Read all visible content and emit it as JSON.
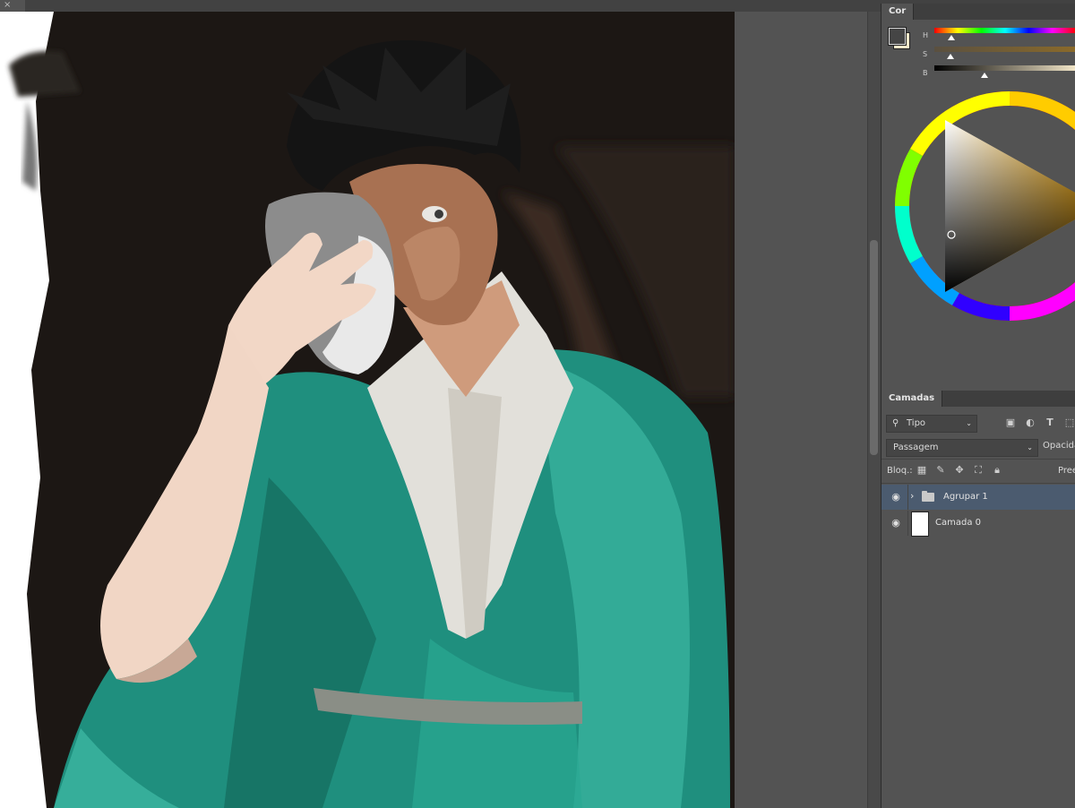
{
  "document_tab": {
    "close_glyph": "×"
  },
  "color_panel": {
    "tab_label": "Cor",
    "sliders": [
      {
        "label": "H",
        "value_fraction": 0.12
      },
      {
        "label": "S",
        "value_fraction": 0.12
      },
      {
        "label": "B",
        "value_fraction": 0.36
      }
    ],
    "foreground_color": "#454545",
    "background_color": "#f3e7c9",
    "wheel_hue_color": "#f5a700"
  },
  "layers_panel": {
    "tab_label": "Camadas",
    "filter": {
      "label": "Tipo",
      "icon": "search-icon"
    },
    "filter_icons": [
      "image-filter-icon",
      "adjustment-filter-icon",
      "type-filter-icon",
      "shape-filter-icon"
    ],
    "blend_mode": "Passagem",
    "opacity_label": "Opacida",
    "lock_label": "Bloq.:",
    "lock_icons": [
      "lock-transparent-pixels-icon",
      "lock-image-pixels-icon",
      "lock-position-icon",
      "lock-artboard-icon",
      "lock-all-icon"
    ],
    "fill_label": "Pree",
    "layers": [
      {
        "name": "Agrupar 1",
        "type": "group",
        "visible": true,
        "selected": true
      },
      {
        "name": "Camada 0",
        "type": "layer",
        "visible": true,
        "selected": false
      }
    ]
  }
}
